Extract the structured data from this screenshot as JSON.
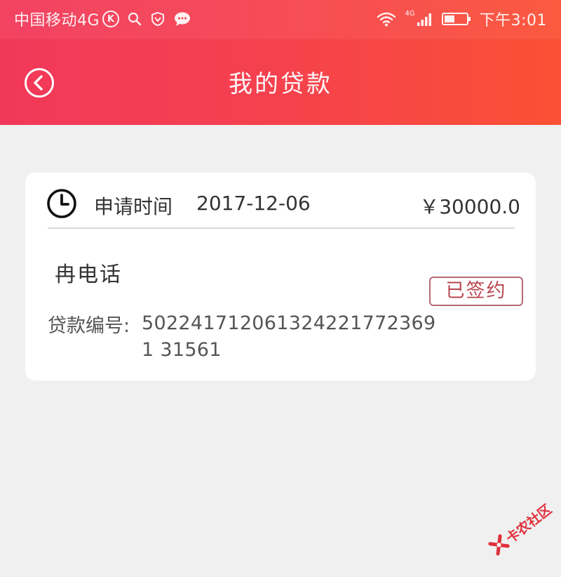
{
  "status_bar": {
    "carrier": "中国移动4G",
    "k_badge": "K",
    "network_label": "4G",
    "time": "下午3:01"
  },
  "title_bar": {
    "title": "我的贷款",
    "back_icon": "back-circle-icon"
  },
  "loan_card": {
    "clock_icon": "clock-icon",
    "apply_label": "申请时间",
    "apply_date": "2017-12-06",
    "amount": "￥30000.0",
    "borrower_name": "冉电话",
    "status": "已签约",
    "loan_no_label": "贷款编号:",
    "loan_no": "5022417120613242217723691 31561"
  },
  "watermark": {
    "text": "卡农社区"
  },
  "colors": {
    "header_gradient_start": "#f2385a",
    "header_gradient_end": "#fb5035",
    "page_background": "#f0f0f0",
    "badge_text": "#b8444f",
    "badge_border": "#b76a72",
    "watermark": "#e0303b"
  }
}
